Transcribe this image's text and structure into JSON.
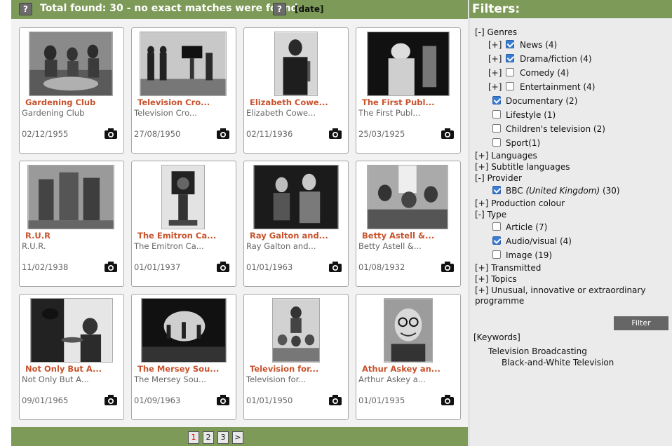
{
  "results": {
    "total_text": "Total found: 30 - no exact matches were found",
    "help_glyph": "?",
    "sort_label": "[date]"
  },
  "cards": [
    {
      "title": "Gardening Club",
      "subtitle": "Gardening Club",
      "date": "02/12/1955",
      "icon": "camera-icon"
    },
    {
      "title": "Television Cro...",
      "subtitle": "Television Cro...",
      "date": "27/08/1950",
      "icon": "camera-icon"
    },
    {
      "title": "Elizabeth Cowe...",
      "subtitle": "Elizabeth Cowe...",
      "date": "02/11/1936",
      "icon": "camera-icon"
    },
    {
      "title": "The First Publ...",
      "subtitle": "The First Publ...",
      "date": "25/03/1925",
      "icon": "camera-icon"
    },
    {
      "title": "R.U.R",
      "subtitle": "R.U.R.",
      "date": "11/02/1938",
      "icon": "camera-icon"
    },
    {
      "title": "The Emitron Ca...",
      "subtitle": "The Emitron Ca...",
      "date": "01/01/1937",
      "icon": "camera-icon"
    },
    {
      "title": "Ray Galton and...",
      "subtitle": "Ray Galton and...",
      "date": "01/01/1963",
      "icon": "camera-icon"
    },
    {
      "title": "Betty Astell &...",
      "subtitle": "Betty Astell &...",
      "date": "01/08/1932",
      "icon": "camera-icon"
    },
    {
      "title": "Not Only But A...",
      "subtitle": "Not Only But A...",
      "date": "09/01/1965",
      "icon": "camera-icon"
    },
    {
      "title": "The Mersey Sou...",
      "subtitle": "The Mersey Sou...",
      "date": "01/09/1963",
      "icon": "camera-icon"
    },
    {
      "title": "Television for...",
      "subtitle": "Television for...",
      "date": "01/01/1950",
      "icon": "camera-icon"
    },
    {
      "title": "Athur Askey an...",
      "subtitle": "Arthur Askey a...",
      "date": "01/01/1935",
      "icon": "camera-icon"
    }
  ],
  "pagination": {
    "pages": [
      "1",
      "2",
      "3"
    ],
    "next": ">"
  },
  "filters": {
    "heading": "Filters:",
    "genres": {
      "label": "[-] Genres",
      "items": [
        {
          "expander": "[+]",
          "label": "News (4)",
          "checked": true
        },
        {
          "expander": "[+]",
          "label": "Drama/fiction (4)",
          "checked": true
        },
        {
          "expander": "[+]",
          "label": "Comedy (4)",
          "checked": false
        },
        {
          "expander": "[+]",
          "label": "Entertainment (4)",
          "checked": false
        },
        {
          "expander": "",
          "label": "Documentary (2)",
          "checked": true
        },
        {
          "expander": "",
          "label": "Lifestyle (1)",
          "checked": false
        },
        {
          "expander": "",
          "label": "Children's television (2)",
          "checked": false
        },
        {
          "expander": "",
          "label": "Sport(1)",
          "checked": false
        }
      ]
    },
    "languages": "[+] Languages",
    "subtitle_languages": "[+] Subtitle languages",
    "provider": {
      "label": "[-] Provider",
      "item_name": "BBC",
      "item_country": "(United Kingdom)",
      "item_count": "(30)",
      "checked": true
    },
    "production_colour": "[+] Production colour",
    "type": {
      "label": "[-] Type",
      "items": [
        {
          "label": "Article (7)",
          "checked": false
        },
        {
          "label": "Audio/visual (4)",
          "checked": true
        },
        {
          "label": "Image (19)",
          "checked": false
        }
      ]
    },
    "transmitted": "[+] Transmitted",
    "topics": "[+] Topics",
    "unusual_line1": "[+] Unusual, innovative or extraordinary",
    "unusual_line2": "programme",
    "filter_button": "Filter",
    "keywords_label": "[Keywords]",
    "keyword_1": "Television Broadcasting",
    "keyword_2": "Black-and-White Television"
  }
}
